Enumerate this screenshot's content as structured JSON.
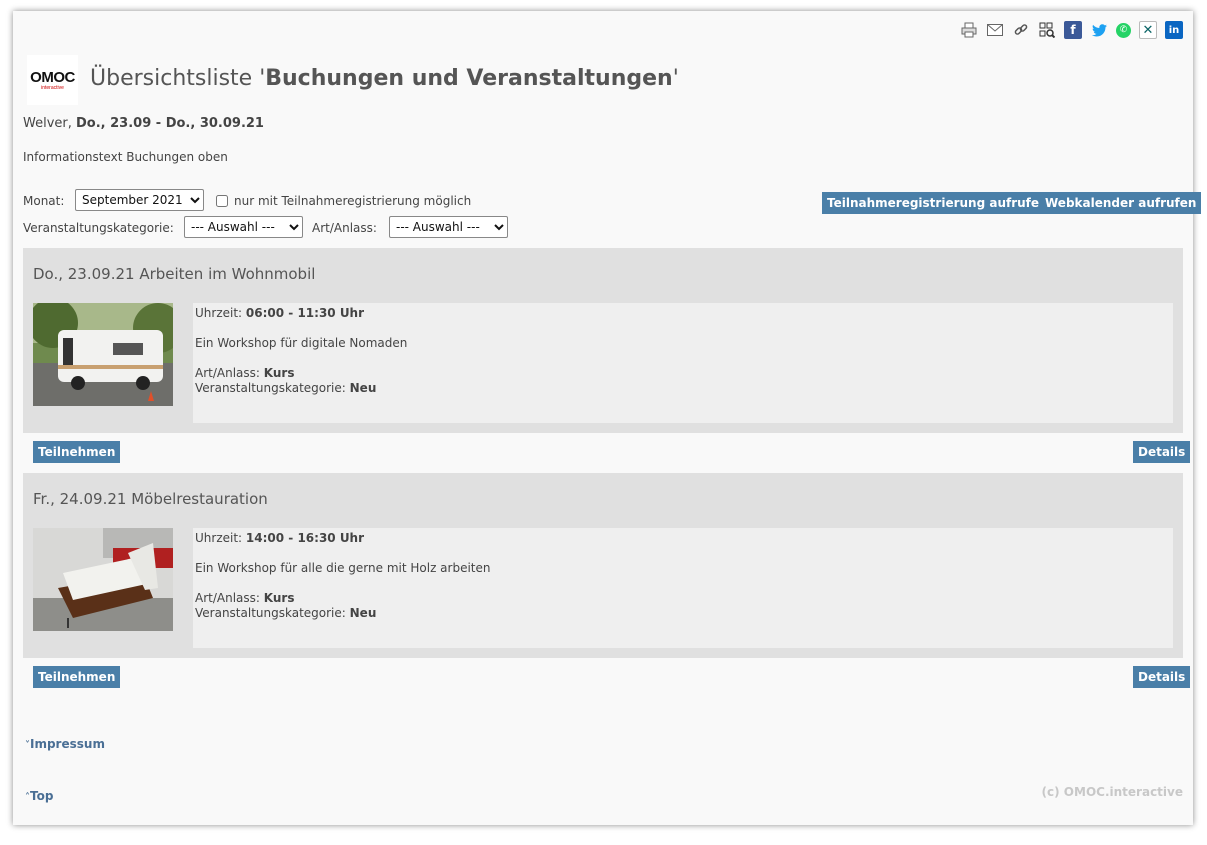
{
  "share_icons": [
    "print-icon",
    "mail-icon",
    "link-icon",
    "qr-code-icon",
    "facebook-icon",
    "twitter-icon",
    "whatsapp-icon",
    "xing-icon",
    "linkedin-icon"
  ],
  "logo": {
    "brand": "OMOC",
    "sub": "interactive"
  },
  "title": {
    "prefix": "Übersichtsliste '",
    "bold": "Buchungen und Veranstaltungen",
    "suffix": "'"
  },
  "dateline": {
    "place": "Welver, ",
    "range": "Do., 23.09 - Do., 30.09.21"
  },
  "infotext": "Informationstext Buchungen oben",
  "filters": {
    "month_label": "Monat:",
    "month_value": "September 2021",
    "checkbox_label": "nur mit Teilnahmeregistrierung möglich",
    "category_label": "Veranstaltungskategorie:",
    "category_value": "--- Auswahl ---",
    "occasion_label": "Art/Anlass:",
    "occasion_value": "--- Auswahl ---"
  },
  "buttons": {
    "registration": "Teilnahmeregistrierung aufrufen",
    "webcalendar": "Webkalender aufrufen"
  },
  "events": [
    {
      "title": "Do., 23.09.21 Arbeiten im Wohnmobil",
      "time_label": "Uhrzeit: ",
      "time": "06:00 - 11:30 Uhr",
      "description": "Ein Workshop für digitale Nomaden",
      "occasion_label": "Art/Anlass: ",
      "occasion": "Kurs",
      "category_label": "Veranstaltungskategorie: ",
      "category": "Neu",
      "join": "Teilnehmen",
      "details": "Details"
    },
    {
      "title": "Fr., 24.09.21 Möbelrestauration",
      "time_label": "Uhrzeit: ",
      "time": "14:00 - 16:30 Uhr",
      "description": "Ein Workshop für alle die gerne mit Holz arbeiten",
      "occasion_label": "Art/Anlass: ",
      "occasion": "Kurs",
      "category_label": "Veranstaltungskategorie: ",
      "category": "Neu",
      "join": "Teilnehmen",
      "details": "Details"
    }
  ],
  "footer": {
    "impressum_arrow": "˅",
    "impressum": "Impressum",
    "top_arrow": "˄",
    "top": "Top",
    "copyright": "(c) OMOC.interactive"
  }
}
